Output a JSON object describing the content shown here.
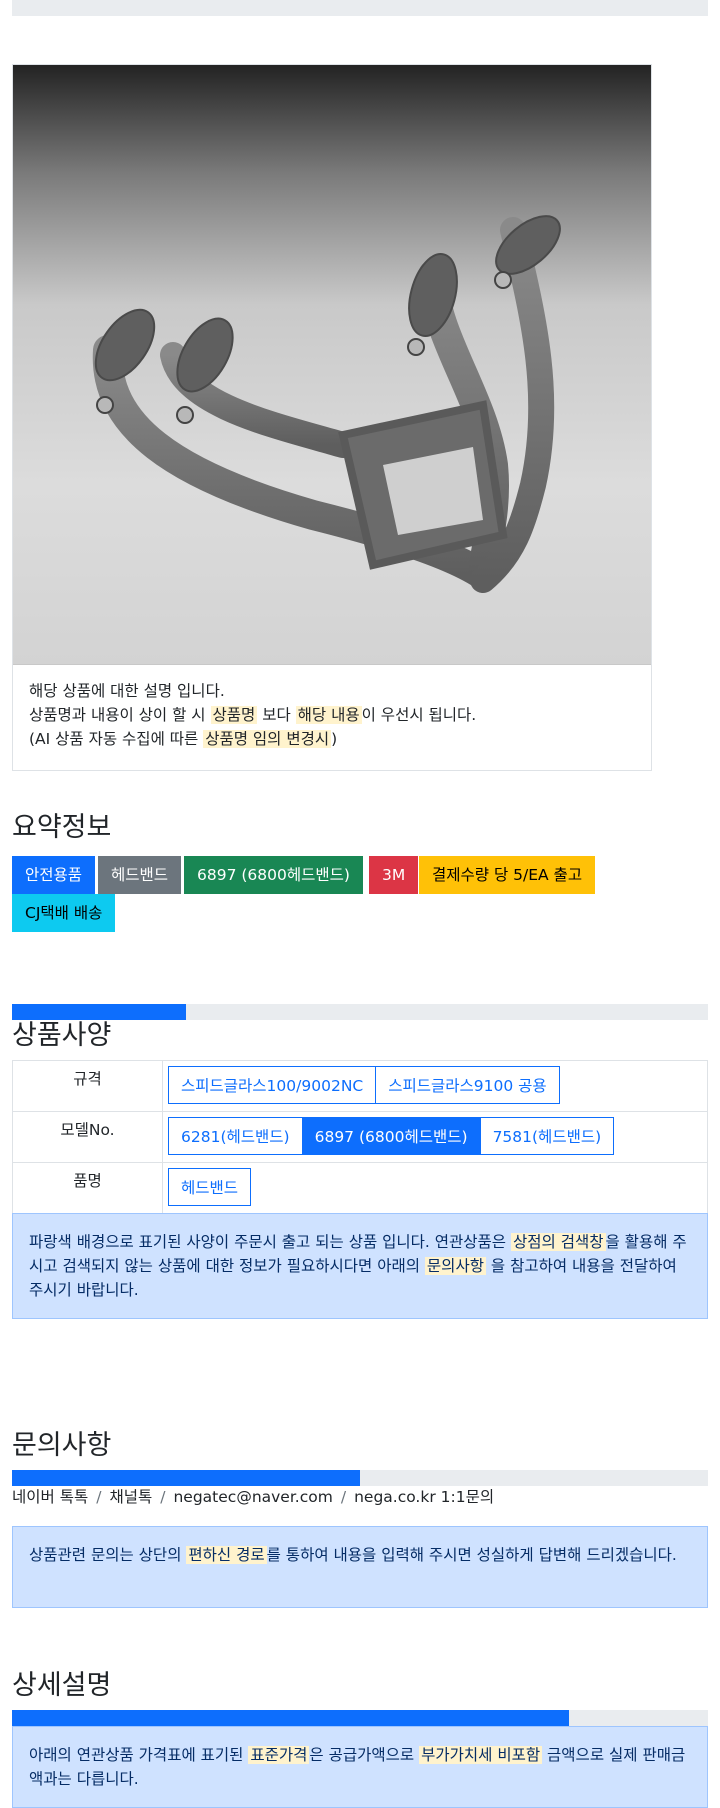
{
  "card": {
    "image_alt": "6897 (6800 헤드밴드) product photo",
    "line1": "해당 상품에 대한 설명 입니다.",
    "line2_a": "상품명과 내용이 상이 할 시 ",
    "line2_mark1": "상품명",
    "line2_b": " 보다 ",
    "line2_mark2": "해당 내용",
    "line2_c": "이 우선시 됩니다.",
    "line3_a": "(AI 상품 자동 수집에 따른 ",
    "line3_mark": "상품명 임의 변경시",
    "line3_b": ")"
  },
  "summary": {
    "title": "요약정보",
    "badges": [
      {
        "label": "안전용품",
        "color": "#0d6efd",
        "text_color": "#ffffff"
      },
      {
        "label": "헤드밴드",
        "color": "#6c757d",
        "text_color": "#ffffff"
      },
      {
        "label": "6897 (6800헤드밴드)",
        "color": "#198754",
        "text_color": "#ffffff"
      },
      {
        "label": "3M",
        "color": "#dc3545",
        "text_color": "#ffffff"
      },
      {
        "label": "결제수량 당 5/EA 출고",
        "color": "#ffc107",
        "text_color": "#000000"
      },
      {
        "label": "CJ택배 배송",
        "color": "#0dcaf0",
        "text_color": "#000000"
      }
    ]
  },
  "spec": {
    "progress": 0.25,
    "title": "상품사양",
    "rows": [
      {
        "label": "규격",
        "options": [
          {
            "text": "스피드글라스100/9002NC",
            "active": false
          },
          {
            "text": "스피드글라스9100 공용",
            "active": false
          }
        ]
      },
      {
        "label": "모델No.",
        "options": [
          {
            "text": "6281(헤드밴드)",
            "active": false
          },
          {
            "text": "6897 (6800헤드밴드)",
            "active": true
          },
          {
            "text": "7581(헤드밴드)",
            "active": false
          }
        ]
      },
      {
        "label": "품명",
        "options": [
          {
            "text": "헤드밴드",
            "active": false
          }
        ]
      }
    ],
    "alert": {
      "a": "파랑색 배경으로 표기된 사양이 주문시 출고 되는 상품 입니다. 연관상품은 ",
      "mark1": "상점의 검색창",
      "b": "을 활용해 주시고 검색되지 않는 상품에 대한 정보가 필요하시다면 아래의 ",
      "mark2": "문의사항",
      "c": " 을 참고하여 내용을 전달하여 주시기 바랍니다."
    }
  },
  "inquiry": {
    "title": "문의사항",
    "progress": 0.5,
    "breadcrumb": [
      "네이버 톡톡",
      "채널톡",
      "negatec@naver.com",
      "nega.co.kr 1:1문의"
    ],
    "alert": {
      "a": "상품관련 문의는 상단의 ",
      "mark": "편하신 경로",
      "b": "를 통하여 내용을 입력해 주시면 성실하게 답변해 드리겠습니다."
    }
  },
  "detail": {
    "title": "상세설명",
    "progress": 0.8,
    "alert": {
      "a": "아래의 연관상품 가격표에 표기된 ",
      "mark1": "표준가격",
      "b": "은 공급가액으로 ",
      "mark2": "부가가치세 비포함",
      "c": " 금액으로 실제 판매금액과는 다릅니다."
    }
  }
}
